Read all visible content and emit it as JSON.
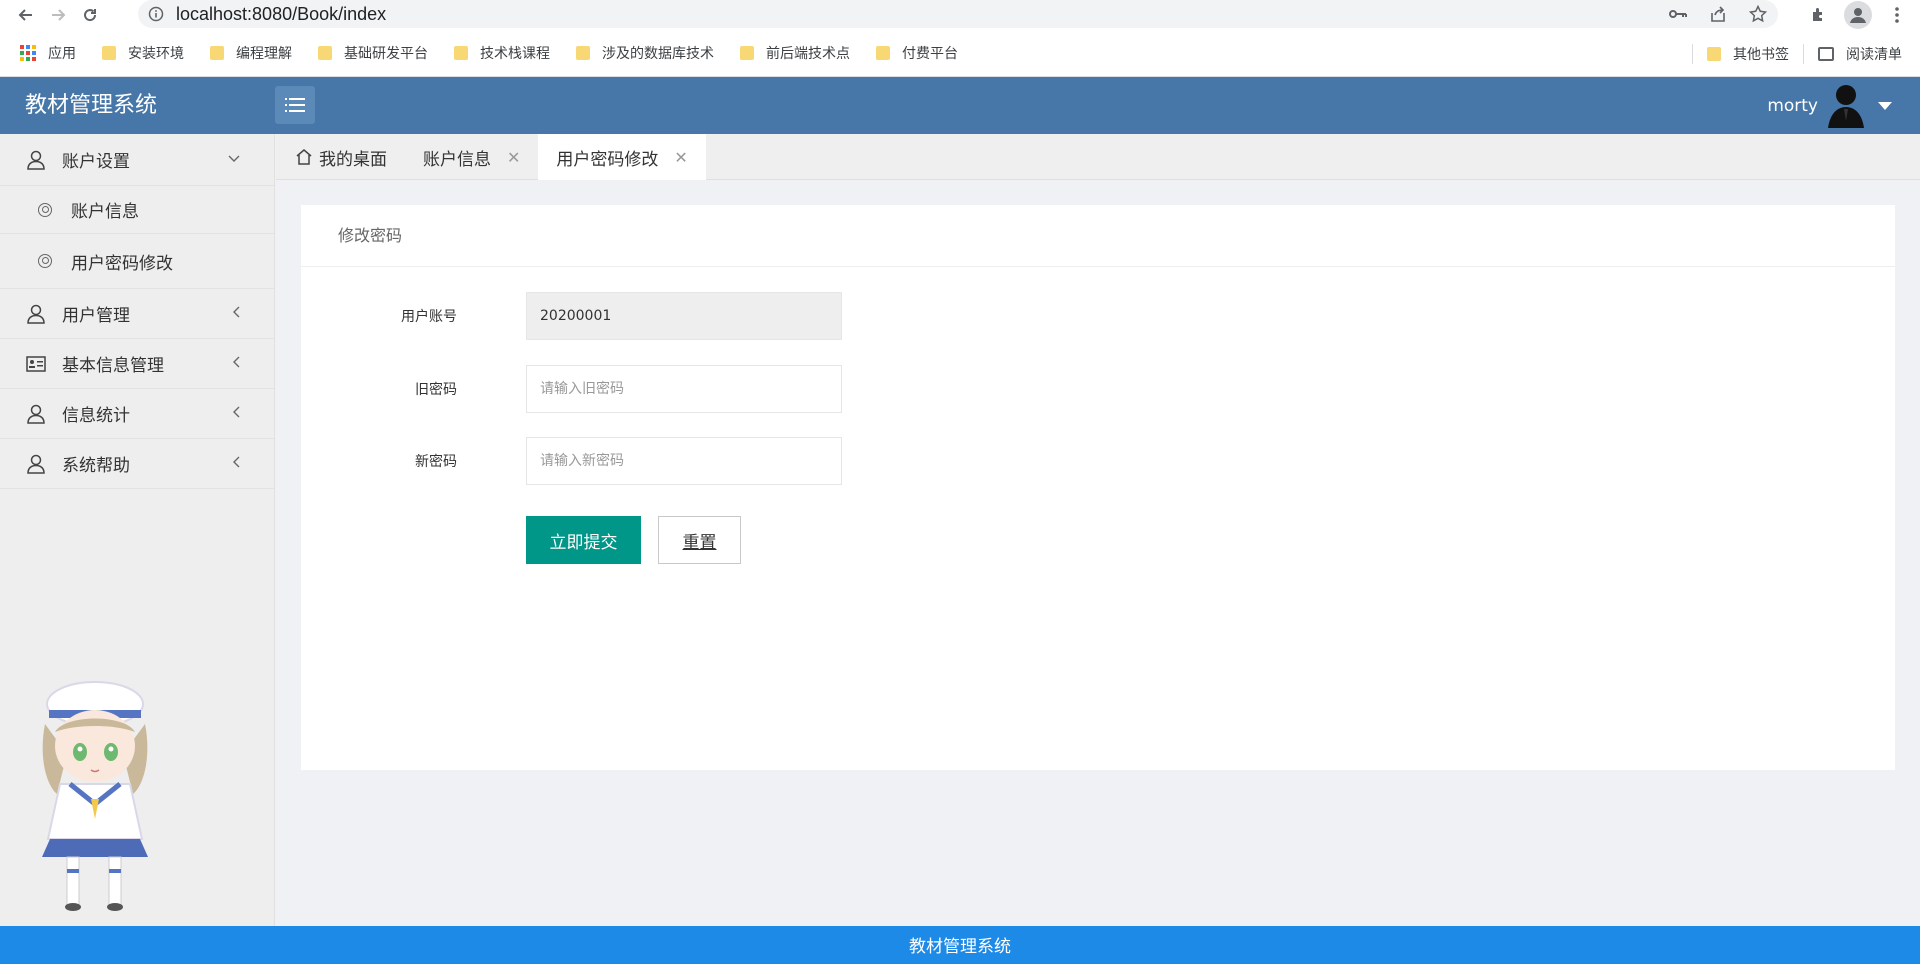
{
  "browser": {
    "url": "localhost:8080/Book/index",
    "bookmarks": [
      {
        "label": "应用",
        "type": "apps"
      },
      {
        "label": "安装环境",
        "type": "folder"
      },
      {
        "label": "编程理解",
        "type": "folder"
      },
      {
        "label": "基础研发平台",
        "type": "folder"
      },
      {
        "label": "技术栈课程",
        "type": "folder"
      },
      {
        "label": "涉及的数据库技术",
        "type": "folder"
      },
      {
        "label": "前后端技术点",
        "type": "folder"
      },
      {
        "label": "付费平台",
        "type": "folder"
      }
    ],
    "other_bookmarks": "其他书签",
    "reading_list": "阅读清单"
  },
  "header": {
    "title": "教材管理系统",
    "username": "morty"
  },
  "sidebar": {
    "items": [
      {
        "label": "账户设置",
        "icon": "user-icon",
        "expanded": true,
        "children": [
          {
            "label": "账户信息"
          },
          {
            "label": "用户密码修改"
          }
        ]
      },
      {
        "label": "用户管理",
        "icon": "user-icon"
      },
      {
        "label": "基本信息管理",
        "icon": "id-card-icon"
      },
      {
        "label": "信息统计",
        "icon": "user-icon"
      },
      {
        "label": "系统帮助",
        "icon": "user-icon"
      }
    ]
  },
  "tabs": [
    {
      "label": "我的桌面",
      "closable": false,
      "active": false
    },
    {
      "label": "账户信息",
      "closable": true,
      "active": false
    },
    {
      "label": "用户密码修改",
      "closable": true,
      "active": true
    }
  ],
  "form": {
    "title": "修改密码",
    "account_label": "用户账号",
    "account_value": "20200001",
    "old_password_label": "旧密码",
    "old_password_placeholder": "请输入旧密码",
    "new_password_label": "新密码",
    "new_password_placeholder": "请输入新密码",
    "submit_label": "立即提交",
    "reset_label": "重置"
  },
  "footer": {
    "text": "教材管理系统"
  },
  "colors": {
    "header_bg": "#4677a8",
    "submit_bg": "#009688",
    "footer_bg": "#1e8ae8"
  }
}
